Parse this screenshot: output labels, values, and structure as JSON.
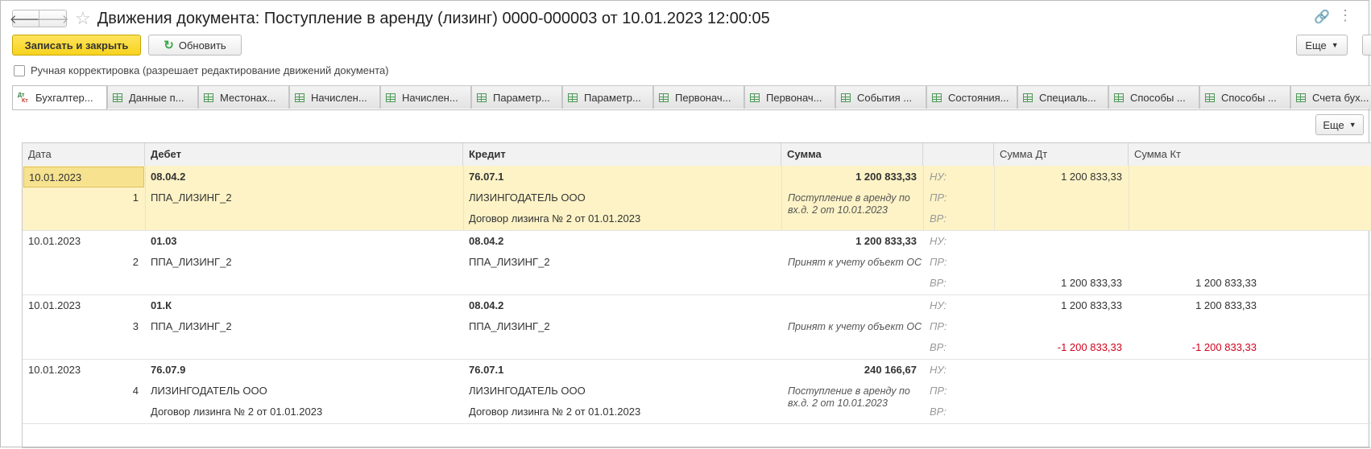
{
  "window": {
    "title": "Движения документа: Поступление в аренду (лизинг) 0000-000003 от 10.01.2023 12:00:05",
    "back_icon": "arrow-left-icon",
    "forward_icon": "arrow-right-icon",
    "favorite_icon": "star-icon"
  },
  "toolbar": {
    "save_close_label": "Записать и закрыть",
    "refresh_label": "Обновить",
    "more_label": "Еще"
  },
  "manual_correction": {
    "label": "Ручная корректировка (разрешает редактирование движений документа)",
    "checked": false
  },
  "tabs": [
    {
      "label": "Бухгалтер...",
      "active": true
    },
    {
      "label": "Данные п..."
    },
    {
      "label": "Местонах..."
    },
    {
      "label": "Начислен..."
    },
    {
      "label": "Начислен..."
    },
    {
      "label": "Параметр..."
    },
    {
      "label": "Параметр..."
    },
    {
      "label": "Первонач..."
    },
    {
      "label": "Первонач..."
    },
    {
      "label": "События ..."
    },
    {
      "label": "Состояния..."
    },
    {
      "label": "Специаль..."
    },
    {
      "label": "Способы ..."
    },
    {
      "label": "Способы ..."
    },
    {
      "label": "Счета бух..."
    }
  ],
  "tab_icon_active": {
    "dt": "Дт",
    "kt": "Кт"
  },
  "table_more_label": "Еще",
  "table": {
    "headers": {
      "date": "Дата",
      "debit": "Дебет",
      "credit": "Кредит",
      "sum": "Сумма",
      "blank": "",
      "sum_dt": "Сумма Дт",
      "sum_kt": "Сумма Кт"
    },
    "rows": [
      {
        "date": "10.01.2023",
        "num": "1",
        "debit": "08.04.2",
        "debit_sub1": "ППА_ЛИЗИНГ_2",
        "debit_sub2": "",
        "credit": "76.07.1",
        "credit_sub1": "ЛИЗИНГОДАТЕЛЬ ООО",
        "credit_sub2": "Договор лизинга № 2 от 01.01.2023",
        "sum": "1 200 833,33",
        "content": "Поступление в аренду по вх.д. 2 от 10.01.2023",
        "nu": "НУ:",
        "pr": "ПР:",
        "vr": "ВР:",
        "nu_dt": "1 200 833,33",
        "nu_kt": "",
        "pr_dt": "",
        "pr_kt": "",
        "vr_dt": "",
        "vr_kt": ""
      },
      {
        "date": "10.01.2023",
        "num": "2",
        "debit": "01.03",
        "debit_sub1": "ППА_ЛИЗИНГ_2",
        "debit_sub2": "",
        "credit": "08.04.2",
        "credit_sub1": "ППА_ЛИЗИНГ_2",
        "credit_sub2": "",
        "sum": "1 200 833,33",
        "content": "Принят к учету объект ОС",
        "nu": "НУ:",
        "pr": "ПР:",
        "vr": "ВР:",
        "nu_dt": "",
        "nu_kt": "",
        "pr_dt": "",
        "pr_kt": "",
        "vr_dt": "1 200 833,33",
        "vr_kt": "1 200 833,33"
      },
      {
        "date": "10.01.2023",
        "num": "3",
        "debit": "01.К",
        "debit_sub1": "ППА_ЛИЗИНГ_2",
        "debit_sub2": "",
        "credit": "08.04.2",
        "credit_sub1": "ППА_ЛИЗИНГ_2",
        "credit_sub2": "",
        "sum": "",
        "content": "Принят к учету объект ОС",
        "nu": "НУ:",
        "pr": "ПР:",
        "vr": "ВР:",
        "nu_dt": "1 200 833,33",
        "nu_kt": "1 200 833,33",
        "pr_dt": "",
        "pr_kt": "",
        "vr_dt": "-1 200 833,33",
        "vr_kt": "-1 200 833,33"
      },
      {
        "date": "10.01.2023",
        "num": "4",
        "debit": "76.07.9",
        "debit_sub1": "ЛИЗИНГОДАТЕЛЬ ООО",
        "debit_sub2": "Договор лизинга № 2 от 01.01.2023",
        "credit": "76.07.1",
        "credit_sub1": "ЛИЗИНГОДАТЕЛЬ ООО",
        "credit_sub2": "Договор лизинга № 2 от 01.01.2023",
        "sum": "240 166,67",
        "content": "Поступление в аренду по вх.д. 2 от 10.01.2023",
        "nu": "НУ:",
        "pr": "ПР:",
        "vr": "ВР:",
        "nu_dt": "",
        "nu_kt": "",
        "pr_dt": "",
        "pr_kt": "",
        "vr_dt": "",
        "vr_kt": ""
      }
    ]
  },
  "colors": {
    "primary_button": "#f7d31e",
    "selected_row": "#fdf3c6",
    "negative": "#d0021b"
  }
}
